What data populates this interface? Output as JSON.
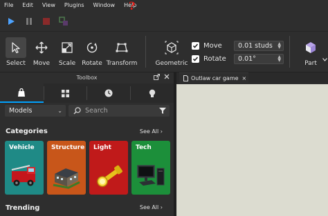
{
  "menu": {
    "items": [
      "File",
      "Edit",
      "View",
      "Plugins",
      "Window",
      "Help"
    ],
    "annotation": "?"
  },
  "run_controls": {
    "icons": [
      "play-icon",
      "pause-icon",
      "stop-icon",
      "client-server-icon"
    ]
  },
  "ribbon": {
    "tools": [
      {
        "label": "Select",
        "icon": "cursor-icon",
        "active": true
      },
      {
        "label": "Move",
        "icon": "move-arrows-icon"
      },
      {
        "label": "Scale",
        "icon": "scale-icon"
      },
      {
        "label": "Rotate",
        "icon": "rotate-icon"
      },
      {
        "label": "Transform",
        "icon": "transform-icon"
      }
    ],
    "geometric_label": "Geometric",
    "snap": {
      "move_label": "Move",
      "move_value": "0.01 studs",
      "rotate_label": "Rotate",
      "rotate_value": "0.01°"
    },
    "part_label": "Part"
  },
  "toolbox": {
    "title": "Toolbox",
    "tabs": [
      "inventory-bag-icon",
      "grid-icon",
      "clock-icon",
      "lightbulb-icon"
    ],
    "category_select": "Models",
    "search_placeholder": "Search",
    "categories_title": "Categories",
    "see_all": "See All",
    "categories": [
      {
        "label": "Vehicle",
        "color": "#1f8a86"
      },
      {
        "label": "Structure",
        "color": "#c8561a"
      },
      {
        "label": "Light",
        "color": "#c01a1a"
      },
      {
        "label": "Tech",
        "color": "#1c8f3a"
      }
    ],
    "trending_title": "Trending"
  },
  "viewport": {
    "tab_label": "Outlaw car game",
    "close": "×"
  },
  "colors": {
    "accent": "#00a2ff",
    "panel": "#2e2e2e",
    "viewport": "#dcdcd0",
    "annotation_red": "#e0201a"
  }
}
